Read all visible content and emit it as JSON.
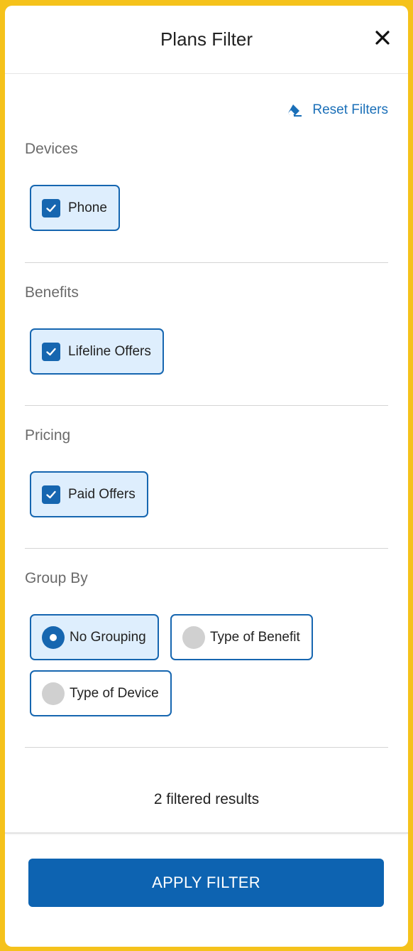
{
  "header": {
    "title": "Plans Filter",
    "close_icon": "close-icon"
  },
  "reset": {
    "label": "Reset Filters",
    "icon": "eraser-icon"
  },
  "sections": {
    "devices": {
      "title": "Devices",
      "options": [
        {
          "label": "Phone",
          "checked": true
        }
      ]
    },
    "benefits": {
      "title": "Benefits",
      "options": [
        {
          "label": "Lifeline Offers",
          "checked": true
        }
      ]
    },
    "pricing": {
      "title": "Pricing",
      "options": [
        {
          "label": "Paid Offers",
          "checked": true
        }
      ]
    },
    "group_by": {
      "title": "Group By",
      "options": [
        {
          "label": "No Grouping",
          "selected": true
        },
        {
          "label": "Type of Benefit",
          "selected": false
        },
        {
          "label": "Type of Device",
          "selected": false
        }
      ]
    }
  },
  "results_text": "2 filtered results",
  "apply_label": "APPLY FILTER",
  "colors": {
    "accent": "#1666b0",
    "selected_bg": "#deeefd",
    "frame": "#f5c21b",
    "link": "#1a6fb8"
  }
}
